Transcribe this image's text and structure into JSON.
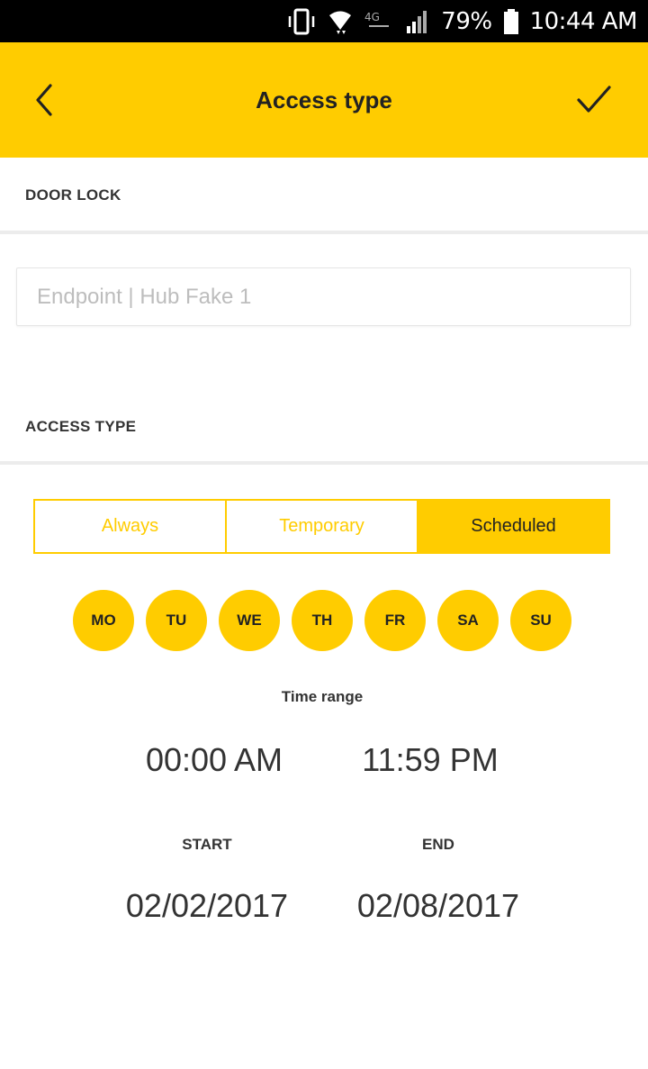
{
  "status_bar": {
    "battery_percent": "79%",
    "time": "10:44 AM",
    "icons": [
      "vibrate-icon",
      "wifi-icon",
      "lte-icon",
      "signal-icon",
      "battery-icon"
    ]
  },
  "header": {
    "title": "Access type",
    "back_icon": "chevron-left-icon",
    "confirm_icon": "checkmark-icon"
  },
  "door_lock": {
    "label": "DOOR LOCK",
    "placeholder": "Endpoint | Hub Fake 1"
  },
  "access_type": {
    "label": "ACCESS TYPE",
    "options": [
      "Always",
      "Temporary",
      "Scheduled"
    ],
    "selected": "Scheduled",
    "days": [
      "MO",
      "TU",
      "WE",
      "TH",
      "FR",
      "SA",
      "SU"
    ]
  },
  "time_range": {
    "label": "Time range",
    "start_time": "00:00 AM",
    "end_time": "11:59 PM"
  },
  "dates": {
    "start_label": "START",
    "end_label": "END",
    "start_date": "02/02/2017",
    "end_date": "02/08/2017"
  },
  "colors": {
    "accent": "#ffcc00",
    "text": "#222222",
    "placeholder": "#bdbdbd"
  }
}
